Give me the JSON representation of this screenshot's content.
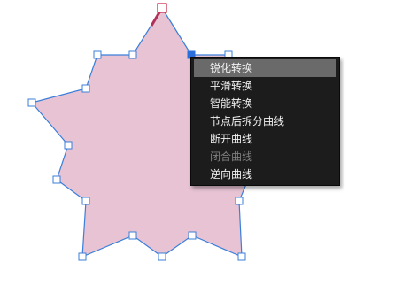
{
  "context_menu": {
    "items": [
      {
        "label": "锐化转换",
        "state": "highlighted"
      },
      {
        "label": "平滑转换",
        "state": "normal"
      },
      {
        "label": "智能转换",
        "state": "normal"
      },
      {
        "label": "节点后拆分曲线",
        "state": "normal"
      },
      {
        "label": "断开曲线",
        "state": "normal"
      },
      {
        "label": "闭合曲线",
        "state": "disabled"
      },
      {
        "label": "逆向曲线",
        "state": "normal"
      }
    ]
  },
  "colors": {
    "shape_fill": "#e7c3d3",
    "path_stroke": "#3a7fd9",
    "selected_segment": "#b2305a",
    "selected_node": "#c9324f",
    "active_node": "#2a6fdb",
    "menu_bg": "#1c1c1c",
    "menu_highlight": "#6a6a6a",
    "menu_text": "#f2f2f2",
    "menu_disabled_text": "#7d7d7d"
  }
}
